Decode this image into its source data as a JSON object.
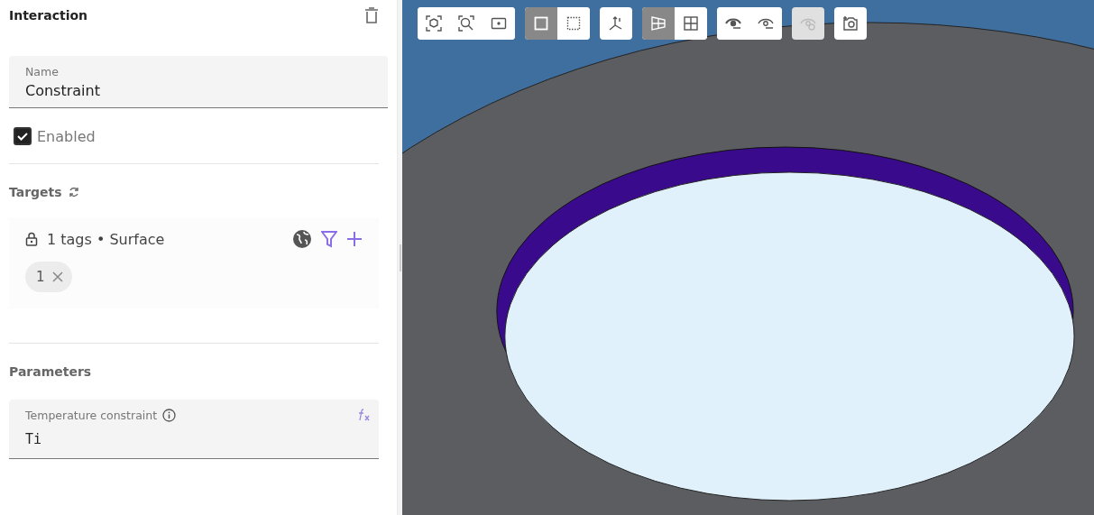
{
  "panel": {
    "title": "Interaction",
    "name_field": {
      "label": "Name",
      "value": "Constraint"
    },
    "enabled": {
      "label": "Enabled",
      "checked": true
    },
    "targets": {
      "title": "Targets",
      "summary": "1 tags • Surface",
      "tags": [
        {
          "label": "1"
        }
      ]
    },
    "parameters": {
      "title": "Parameters",
      "field": {
        "label": "Temperature constraint",
        "value": "Ti"
      }
    }
  },
  "toolbar": [
    {
      "buttons": [
        {
          "kind": "cube",
          "selected": false,
          "disabled": false
        },
        {
          "kind": "zoom",
          "selected": false,
          "disabled": false
        },
        {
          "kind": "frame",
          "selected": false,
          "disabled": false
        }
      ]
    },
    {
      "buttons": [
        {
          "kind": "solid-square",
          "selected": true,
          "disabled": false
        },
        {
          "kind": "dotted-square",
          "selected": false,
          "disabled": false
        }
      ]
    },
    {
      "buttons": [
        {
          "kind": "axes",
          "selected": false,
          "disabled": false
        }
      ]
    },
    {
      "buttons": [
        {
          "kind": "perspective",
          "selected": true,
          "disabled": false
        },
        {
          "kind": "grid",
          "selected": false,
          "disabled": false
        }
      ]
    },
    {
      "buttons": [
        {
          "kind": "eye-solid",
          "selected": false,
          "disabled": false
        },
        {
          "kind": "eye-outline",
          "selected": false,
          "disabled": false
        }
      ]
    },
    {
      "buttons": [
        {
          "kind": "eye-refresh",
          "selected": false,
          "disabled": true
        }
      ]
    },
    {
      "buttons": [
        {
          "kind": "camera",
          "selected": false,
          "disabled": false
        }
      ]
    }
  ]
}
